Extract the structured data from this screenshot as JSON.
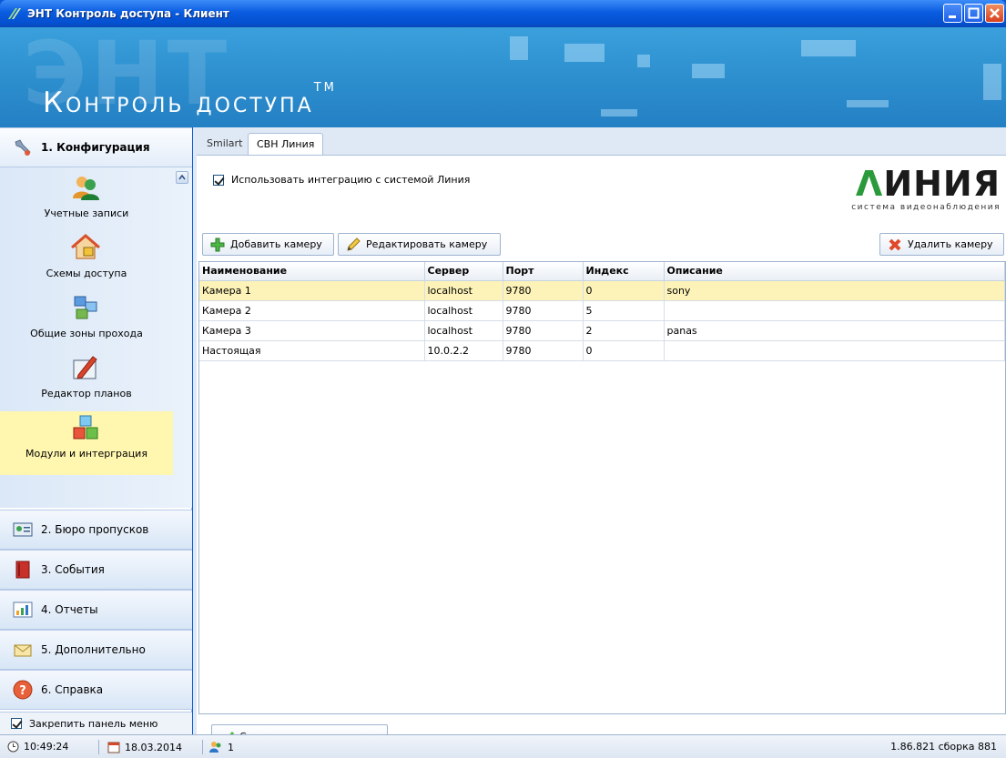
{
  "window": {
    "title": "ЭНТ Контроль доступа - Клиент"
  },
  "banner": {
    "brand": "Контроль доступа",
    "tm": "TM"
  },
  "sidebar": {
    "sections": [
      {
        "label": "1. Конфигурация",
        "icon": "wrench-icon"
      },
      {
        "label": "2. Бюро пропусков",
        "icon": "id-card-icon"
      },
      {
        "label": "3. События",
        "icon": "book-icon"
      },
      {
        "label": "4. Отчеты",
        "icon": "chart-icon"
      },
      {
        "label": "5. Дополнительно",
        "icon": "envelope-icon"
      },
      {
        "label": "6. Справка",
        "icon": "help-icon"
      }
    ],
    "items": [
      {
        "label": "Учетные записи",
        "icon": "users-icon"
      },
      {
        "label": "Схемы доступа",
        "icon": "house-lock-icon"
      },
      {
        "label": "Общие зоны прохода",
        "icon": "network-icon"
      },
      {
        "label": "Редактор планов",
        "icon": "pencil-plan-icon"
      },
      {
        "label": "Модули и интерграция",
        "icon": "cubes-icon"
      }
    ],
    "pin_label": "Закрепить панель меню"
  },
  "tabs": [
    "Smilart",
    "СВН Линия"
  ],
  "integration": {
    "checkbox_label": "Использовать интеграцию с системой Линия",
    "checked": true
  },
  "logo": {
    "word_a": "Λ",
    "word_b": "ИНИЯ",
    "subtitle": "система видеонаблюдения"
  },
  "toolbar": {
    "add": "Добавить камеру",
    "edit": "Редактировать камеру",
    "delete": "Удалить камеру"
  },
  "grid": {
    "columns": [
      "Наименование",
      "Сервер",
      "Порт",
      "Индекс",
      "Описание"
    ],
    "rows": [
      [
        "Камера 1",
        "localhost",
        "9780",
        "0",
        "sony"
      ],
      [
        "Камера 2",
        "localhost",
        "9780",
        "5",
        ""
      ],
      [
        "Камера 3",
        "localhost",
        "9780",
        "2",
        "panas"
      ],
      [
        "Настоящая",
        "10.0.2.2",
        "9780",
        "0",
        ""
      ]
    ],
    "selected_row": 0
  },
  "save_button": "Сохранить изменения",
  "status": {
    "time": "10:49:24",
    "date": "18.03.2014",
    "users": "1",
    "version": "1.86.821 сборка 881"
  }
}
